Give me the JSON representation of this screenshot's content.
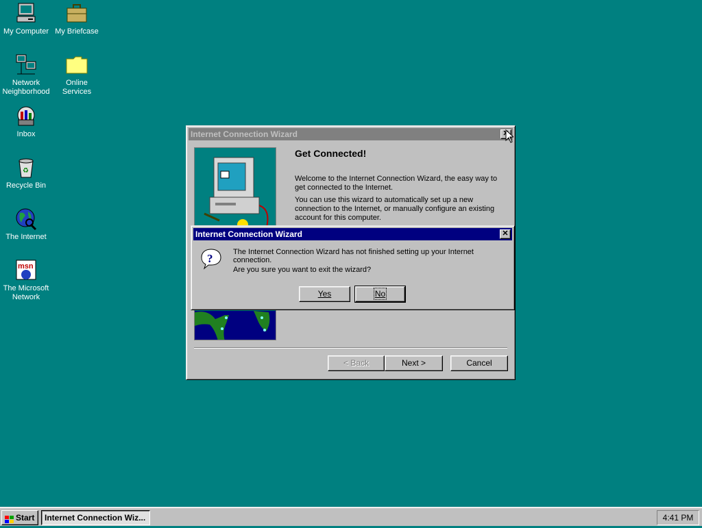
{
  "desktop": {
    "icons": [
      {
        "label": "My Computer",
        "icon": "computer-icon"
      },
      {
        "label": "My Briefcase",
        "icon": "briefcase-icon"
      },
      {
        "label": "Network Neighborhood",
        "icon": "network-icon"
      },
      {
        "label": "Online Services",
        "icon": "folder-icon"
      },
      {
        "label": "Inbox",
        "icon": "inbox-icon"
      },
      {
        "label": "Recycle Bin",
        "icon": "recycle-bin-icon"
      },
      {
        "label": "The Internet",
        "icon": "internet-globe-icon"
      },
      {
        "label": "The Microsoft Network",
        "icon": "msn-icon"
      }
    ],
    "background_color": "#008080"
  },
  "wizard": {
    "title": "Internet Connection Wizard",
    "heading": "Get Connected!",
    "para1": "Welcome to the Internet Connection Wizard, the easy way to get connected to the Internet.",
    "para2": "You can use this wizard to automatically set up a new connection to the Internet, or manually configure an existing account for this computer.",
    "back_label": "< Back",
    "next_label": "Next >",
    "cancel_label": "Cancel",
    "close_glyph": "✕"
  },
  "dialog": {
    "title": "Internet Connection Wizard",
    "message": "The Internet Connection Wizard has not finished setting up your Internet connection.",
    "question": "Are you sure you want to exit the wizard?",
    "yes_label": "Yes",
    "no_label": "No",
    "icon": "question-icon",
    "close_glyph": "✕"
  },
  "taskbar": {
    "start_label": "Start",
    "task_label": "Internet Connection Wiz...",
    "clock": "4:41 PM"
  }
}
